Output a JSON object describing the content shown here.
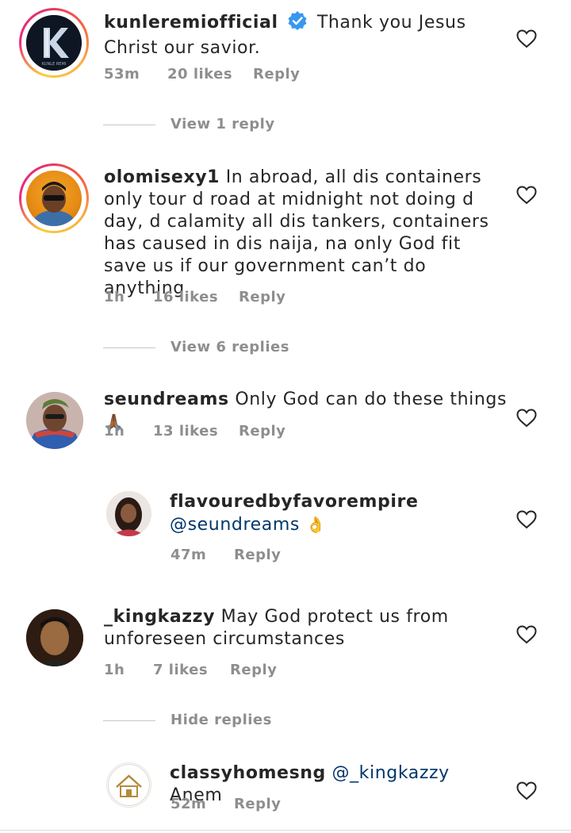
{
  "comments": [
    {
      "username": "kunleremiofficial",
      "verified": true,
      "text": "Thank you Jesus Christ our savior.",
      "avatar_text": "KUNLE REMI",
      "time": "53m",
      "likes": "20 likes",
      "reply": "Reply",
      "thread_toggle": "View 1 reply"
    },
    {
      "username": "olomisexy1",
      "text": "In abroad, all dis containers only tour d road at midnight not doing d day, d calamity all dis tankers, containers has caused in dis naija, na only God fit save us if our government can’t do anything",
      "time": "1h",
      "likes": "16 likes",
      "reply": "Reply",
      "thread_toggle": "View 6 replies"
    },
    {
      "username": "seundreams",
      "text": "Only God can do these things",
      "emoji": "🙏🏾",
      "time": "1h",
      "likes": "13 likes",
      "reply": "Reply"
    },
    {
      "username": "flavouredbyfavorempire",
      "mention": "@seundreams",
      "emoji": "👌",
      "time": "47m",
      "reply": "Reply"
    },
    {
      "username": "_kingkazzy",
      "text": "May God protect us from unforeseen circumstances",
      "time": "1h",
      "likes": "7 likes",
      "reply": "Reply",
      "thread_toggle": "Hide replies"
    },
    {
      "username": "classyhomesng",
      "mention": "@_kingkazzy",
      "text": "Anem",
      "time": "52m",
      "reply": "Reply"
    }
  ],
  "colors": {
    "text": "#262626",
    "meta": "#8e8e8e",
    "mention": "#00376b",
    "verified": "#3897f0",
    "divider": "#c7c7c7"
  },
  "icons": {
    "like": "heart-outline-icon",
    "verified": "verified-badge-icon"
  }
}
